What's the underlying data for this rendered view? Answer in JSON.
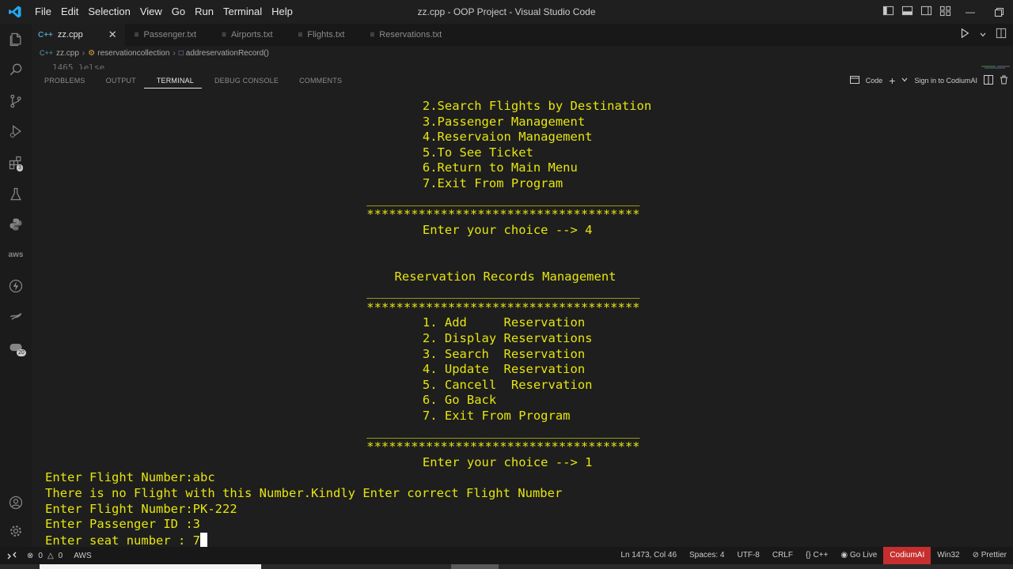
{
  "titlebar": {
    "menu": [
      "File",
      "Edit",
      "Selection",
      "View",
      "Go",
      "Run",
      "Terminal",
      "Help"
    ],
    "title": "zz.cpp - OOP Project - Visual Studio Code"
  },
  "activity": {
    "extensions_badge": "3",
    "accounts_badge": "20",
    "aws_label": "aws"
  },
  "tabs": [
    {
      "icon": "C++",
      "label": "zz.cpp",
      "active": true
    },
    {
      "icon": "≡",
      "label": "Passenger.txt"
    },
    {
      "icon": "≡",
      "label": "Airports.txt"
    },
    {
      "icon": "≡",
      "label": "Flights.txt"
    },
    {
      "icon": "≡",
      "label": "Reservations.txt"
    }
  ],
  "breadcrumb": {
    "file_icon": "C++",
    "file": "zz.cpp",
    "class": "reservationcollection",
    "method": "addreservationRecord()"
  },
  "code_peek": "1465         }else",
  "panel": {
    "tabs": [
      "PROBLEMS",
      "OUTPUT",
      "TERMINAL",
      "DEBUG CONSOLE",
      "COMMENTS"
    ],
    "active_tab": "TERMINAL",
    "shell_label": "Code",
    "sign_in": "Sign in to CodiumAI"
  },
  "terminal": {
    "lines": [
      {
        "text": "2.Search Flights by Destination",
        "col": 56
      },
      {
        "text": "3.Passenger Management",
        "col": 56
      },
      {
        "text": "4.Reservaion Management",
        "col": 56
      },
      {
        "text": "5.To See Ticket",
        "col": 56
      },
      {
        "text": "6.Return to Main Menu",
        "col": 56
      },
      {
        "text": "7.Exit From Program",
        "col": 56
      },
      {
        "text": "_____________________________________",
        "col": 48
      },
      {
        "text": "*************************************",
        "col": 48
      },
      {
        "text": "Enter your choice --> 4",
        "col": 56
      },
      {
        "text": "",
        "col": 0
      },
      {
        "text": "",
        "col": 0
      },
      {
        "text": "Reservation Records Management",
        "col": 52
      },
      {
        "text": "_____________________________________",
        "col": 48
      },
      {
        "text": "*************************************",
        "col": 48
      },
      {
        "text": "1. Add     Reservation",
        "col": 56
      },
      {
        "text": "2. Display Reservations",
        "col": 56
      },
      {
        "text": "3. Search  Reservation",
        "col": 56
      },
      {
        "text": "4. Update  Reservation",
        "col": 56
      },
      {
        "text": "5. Cancell  Reservation",
        "col": 56
      },
      {
        "text": "6. Go Back",
        "col": 56
      },
      {
        "text": "7. Exit From Program",
        "col": 56
      },
      {
        "text": "_____________________________________",
        "col": 48
      },
      {
        "text": "*************************************",
        "col": 48
      },
      {
        "text": "Enter your choice --> 1",
        "col": 56
      },
      {
        "text": "Enter Flight Number:abc",
        "col": 2
      },
      {
        "text": "There is no Flight with this Number.Kindly Enter correct Flight Number",
        "col": 2
      },
      {
        "text": "Enter Flight Number:PK-222",
        "col": 2
      },
      {
        "text": "Enter Passenger ID :3",
        "col": 2
      },
      {
        "text": "Enter seat number : 7",
        "col": 2
      }
    ]
  },
  "statusbar": {
    "errors": "0",
    "warnings": "0",
    "aws": "AWS",
    "position": "Ln 1473, Col 46",
    "spaces": "Spaces: 4",
    "encoding": "UTF-8",
    "eol": "CRLF",
    "language": "C++",
    "go_live": "Go Live",
    "codium": "CodiumAI",
    "platform": "Win32",
    "prettier": "Prettier"
  },
  "colors": {
    "terminal_text": "#e5e510",
    "codium_bg": "#c72e2e",
    "vscode_blue": "#23a9f2"
  }
}
